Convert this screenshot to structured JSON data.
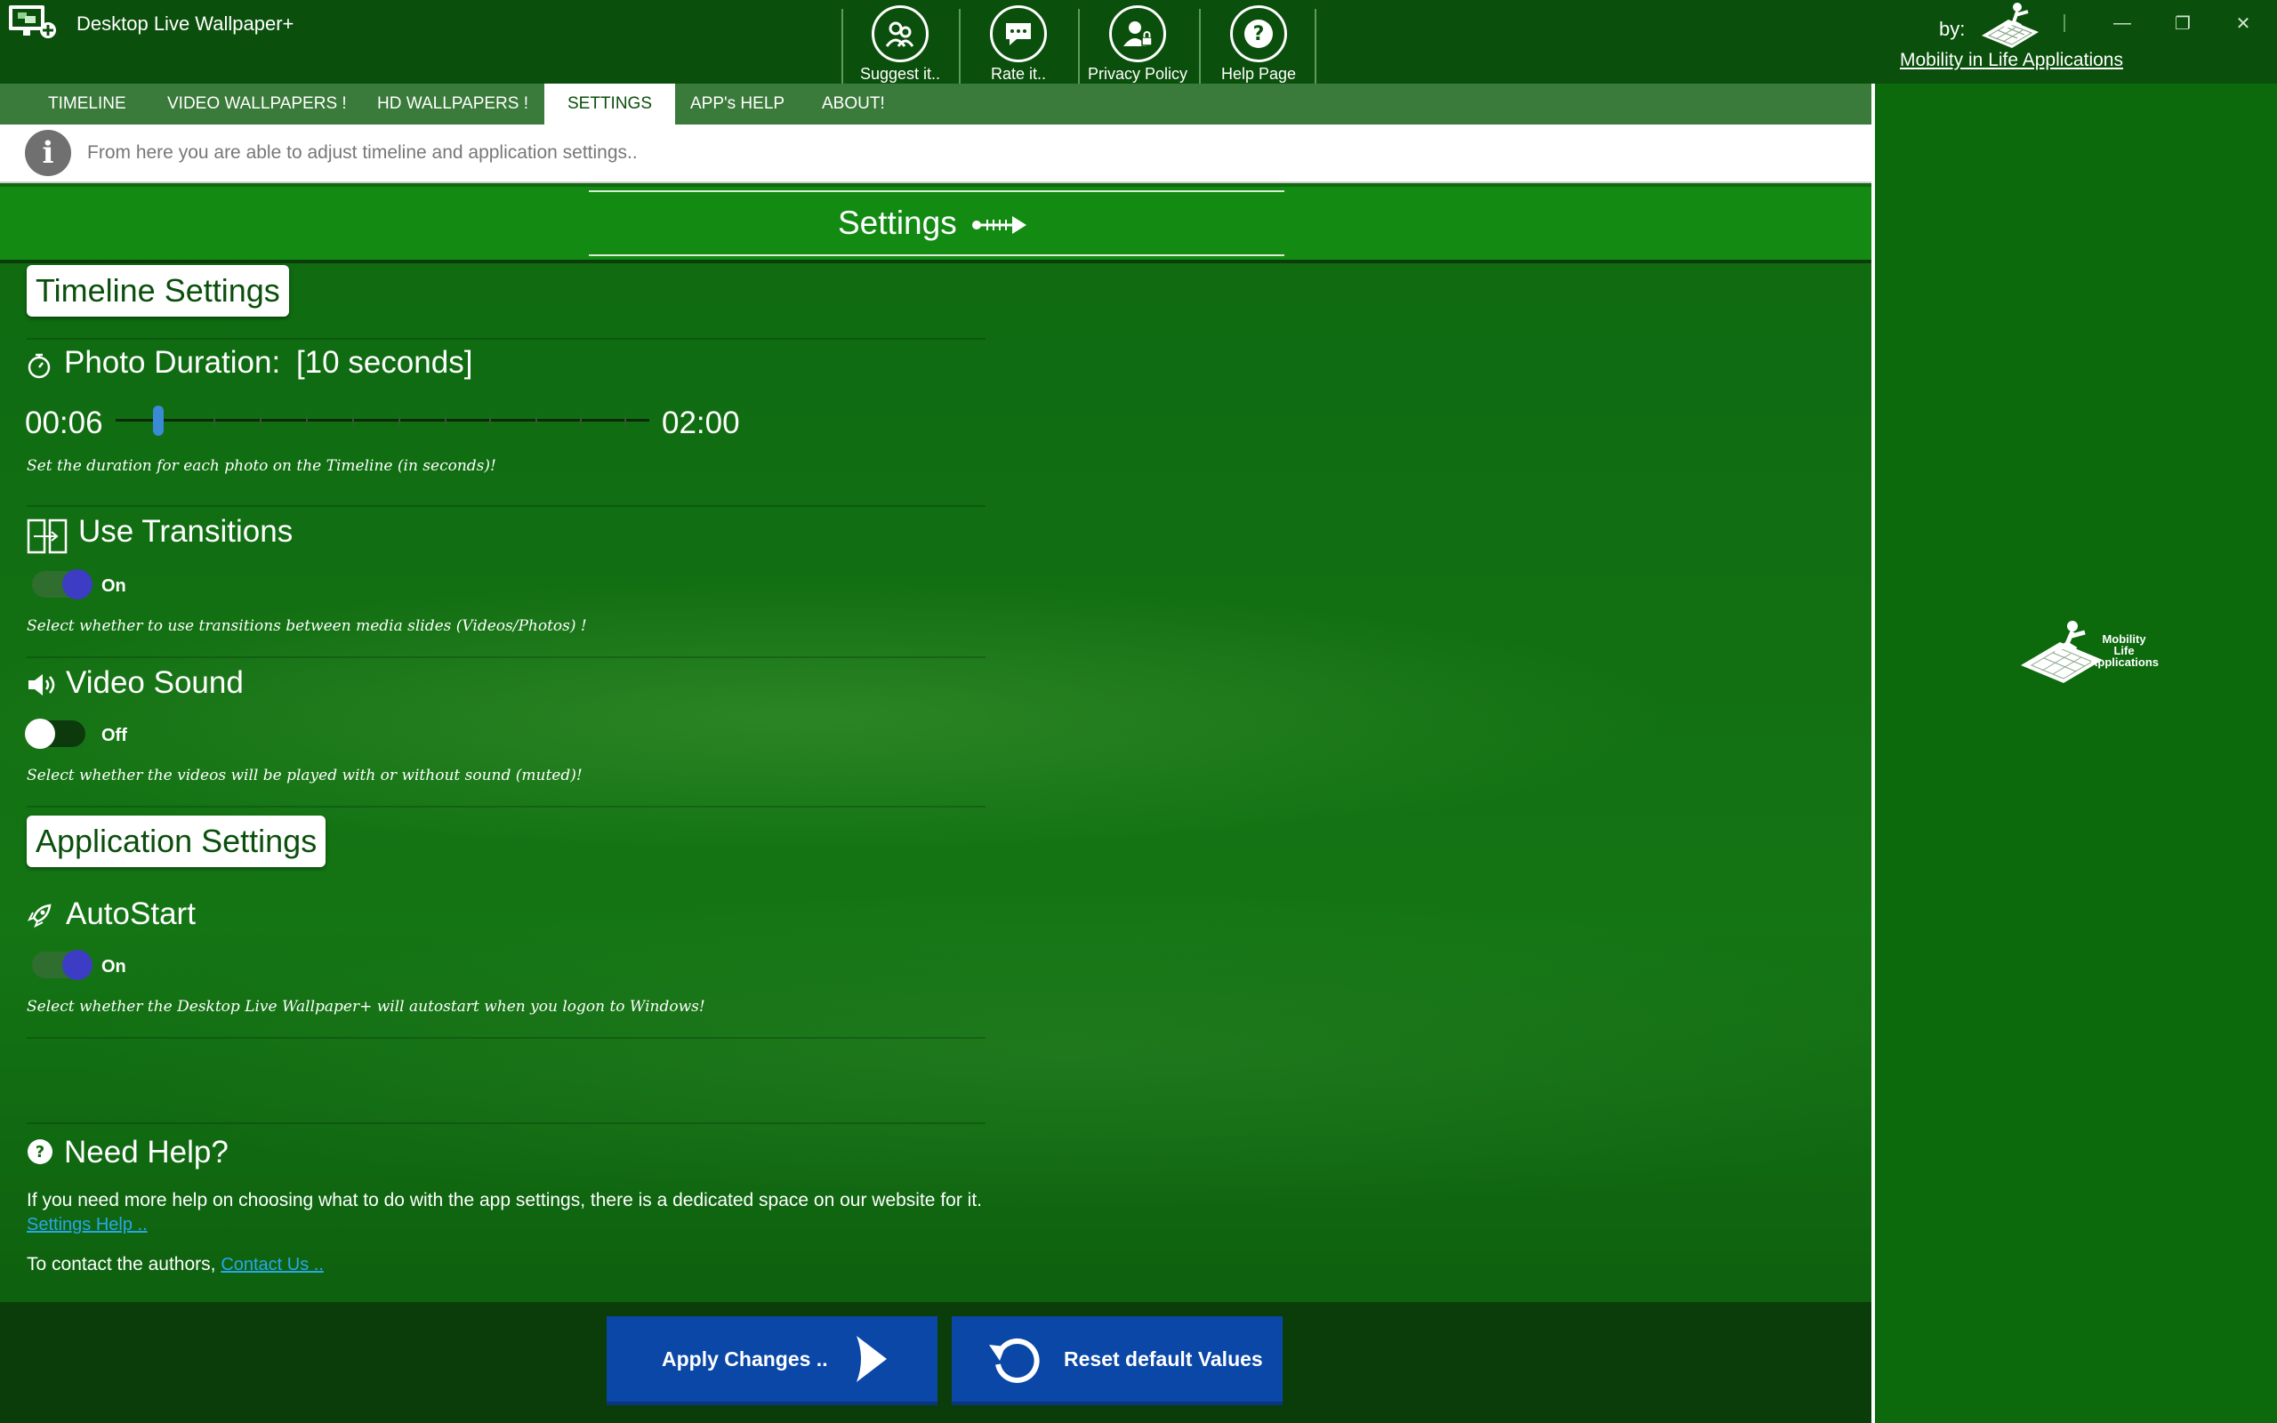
{
  "window": {
    "title": "Desktop Live Wallpaper+",
    "by_label": "by:",
    "company_link": "Mobility in Life Applications",
    "controls": {
      "minimize": "—",
      "maximize": "❐",
      "close": "✕"
    }
  },
  "toolbar": {
    "suggest": "Suggest it..",
    "rate": "Rate it..",
    "privacy": "Privacy Policy",
    "help": "Help Page"
  },
  "tabs": {
    "timeline": "TIMELINE",
    "video": "VIDEO WALLPAPERS !",
    "hd": "HD WALLPAPERS !",
    "settings": "SETTINGS",
    "apphelp": "APP's HELP",
    "about": "ABOUT!",
    "active": "SETTINGS"
  },
  "info": {
    "icon": "i",
    "text": "From here you are able to adjust timeline and application settings.."
  },
  "header": {
    "title": "Settings"
  },
  "timeline_settings": {
    "section_title": "Timeline Settings",
    "photo_duration": {
      "title": "Photo Duration:",
      "value_display": "[10 seconds]",
      "min_label": "00:06",
      "max_label": "02:00",
      "value_seconds": 10,
      "min_seconds": 6,
      "max_seconds": 120,
      "description": "Set the duration for each photo on the Timeline (in seconds)!"
    },
    "use_transitions": {
      "title": "Use Transitions",
      "state": "On",
      "description": "Select whether to use transitions between media slides (Videos/Photos) !"
    },
    "video_sound": {
      "title": "Video Sound",
      "state": "Off",
      "description": "Select whether the videos will be played with or without sound (muted)!"
    }
  },
  "application_settings": {
    "section_title": "Application Settings",
    "autostart": {
      "title": "AutoStart",
      "state": "On",
      "description": "Select whether the Desktop Live Wallpaper+ will autostart when you logon to Windows!"
    }
  },
  "help": {
    "title": "Need Help?",
    "text": "If you need more help on choosing what to do with the app settings, there is a dedicated space on our website for it.",
    "settings_link": "Settings Help ..",
    "contact_prefix": "To contact the authors,",
    "contact_link": "Contact Us .."
  },
  "buttons": {
    "apply": "Apply Changes ..",
    "reset": "Reset default Values"
  },
  "right_logo": {
    "line1": "Mobility",
    "line2": "Life",
    "line3": "Applications"
  },
  "colors": {
    "title_bar": "#0b4f0c",
    "header_green": "#138b13",
    "button_blue": "#0a47a6",
    "toggle_knob_on": "#3c3cc4",
    "link": "#2aa7e6",
    "slider_thumb": "#3a8ad6"
  },
  "icons": {
    "app": "monitor-plus-icon",
    "suggest": "people-icon",
    "rate": "chat-icon",
    "privacy": "person-lock-icon",
    "help": "question-icon",
    "photo_duration": "stopwatch-icon",
    "transitions": "transition-panels-icon",
    "video_sound": "speaker-icon",
    "autostart": "rocket-icon",
    "need_help": "question-circle-icon",
    "apply": "chevron-right-icon",
    "reset": "refresh-icon"
  }
}
